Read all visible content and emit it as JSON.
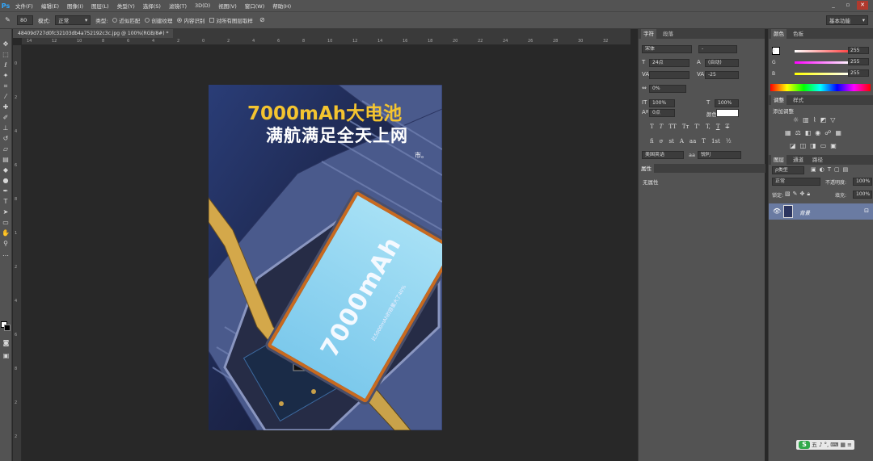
{
  "app": {
    "logo": "Ps",
    "menus": [
      "文件(F)",
      "编辑(E)",
      "图像(I)",
      "图层(L)",
      "类型(Y)",
      "选择(S)",
      "滤镜(T)",
      "3D(D)",
      "视图(V)",
      "窗口(W)",
      "帮助(H)"
    ],
    "window_controls": [
      "_",
      "▫",
      "✕"
    ]
  },
  "options": {
    "brush_size": "80",
    "mode_label": "模式:",
    "mode_value": "正常",
    "type_label": "类型:",
    "type_options": [
      "近似匹配",
      "创建纹理",
      "内容识别"
    ],
    "type_selected": "内容识别",
    "sample_all_layers": "对所有图层取样",
    "workspace": "基本功能"
  },
  "document": {
    "tab_title": "48409d727d0fc32103db4a752192c3c.jpg @ 100%(RGB/8#) *",
    "ruler_top_ticks": [
      "14",
      "12",
      "10",
      "8",
      "6",
      "4",
      "2",
      "0",
      "2",
      "4",
      "6",
      "8",
      "10",
      "12",
      "14",
      "16",
      "18",
      "20",
      "22",
      "24",
      "26",
      "28",
      "30",
      "32"
    ],
    "ruler_left_ticks": [
      "0",
      "2",
      "4",
      "6",
      "8",
      "1",
      "2",
      "4",
      "6",
      "8",
      "2",
      "2"
    ]
  },
  "artwork": {
    "title_line1": "7000mAh大电池",
    "title_line2": "满航满足全天上网",
    "small_mark": "市。",
    "battery_label": "7000mAh",
    "battery_sub": "比5000mAh的容量大了40%"
  },
  "character_panel": {
    "tabs": [
      "字符",
      "段落"
    ],
    "font_family": "宋体",
    "font_style": "-",
    "font_size": "24点",
    "leading": "(自动)",
    "kerning": "",
    "tracking": "-25",
    "scale_percent": "0%",
    "vertical_scale": "100%",
    "horizontal_scale": "100%",
    "baseline_shift": "0点",
    "color_label": "颜色:",
    "style_buttons": [
      "T",
      "T",
      "TT",
      "Tт",
      "T'",
      "T,",
      "T",
      "T"
    ],
    "opentype_buttons": [
      "fi",
      "σ",
      "st",
      "A",
      "aa",
      "T",
      "1st",
      "½"
    ],
    "language": "美国英语",
    "aa_label": "aa",
    "antialias": "锐利"
  },
  "properties_panel": {
    "title": "属性",
    "content": "无属性"
  },
  "color_panel": {
    "tabs": [
      "颜色",
      "色板"
    ],
    "channels": [
      {
        "label": "R",
        "value": "255",
        "color": "#ff3b3b"
      },
      {
        "label": "G",
        "value": "255",
        "color": "#2ee6e6"
      },
      {
        "label": "B",
        "value": "255",
        "color": "#e8e831"
      }
    ]
  },
  "adjust_panel": {
    "tabs": [
      "调整",
      "样式"
    ],
    "add_label": "添加调整"
  },
  "layers_panel": {
    "tabs": [
      "图层",
      "通道",
      "路径"
    ],
    "filter": "ρ类型",
    "blend_mode": "正常",
    "opacity_label": "不透明度:",
    "opacity_value": "100%",
    "lock_label": "锁定:",
    "fill_label": "填充:",
    "fill_value": "100%",
    "layer_name": "背景"
  },
  "ime": {
    "logo": "S",
    "mode": "五",
    "icons": [
      "♪",
      "°,",
      "⌨",
      "▦",
      "≡"
    ]
  }
}
